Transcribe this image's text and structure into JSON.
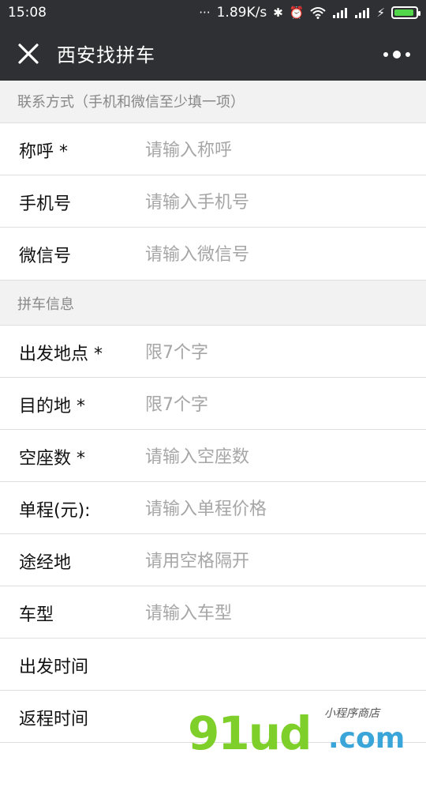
{
  "status_bar": {
    "time": "15:08",
    "indicators": "···",
    "speed": "1.89K/s"
  },
  "titlebar": {
    "title": "西安找拼车"
  },
  "section_contact": {
    "header": "联系方式（手机和微信至少填一项）",
    "rows": [
      {
        "label": "称呼 *",
        "placeholder": "请输入称呼"
      },
      {
        "label": "手机号",
        "placeholder": "请输入手机号"
      },
      {
        "label": "微信号",
        "placeholder": "请输入微信号"
      }
    ]
  },
  "section_trip": {
    "header": "拼车信息",
    "rows": [
      {
        "label": "出发地点 *",
        "placeholder": "限7个字"
      },
      {
        "label": "目的地 *",
        "placeholder": "限7个字"
      },
      {
        "label": "空座数 *",
        "placeholder": "请输入空座数"
      },
      {
        "label": "单程(元):",
        "placeholder": "请输入单程价格"
      },
      {
        "label": "途经地",
        "placeholder": "请用空格隔开"
      },
      {
        "label": "车型",
        "placeholder": "请输入车型"
      },
      {
        "label": "出发时间",
        "placeholder": ""
      },
      {
        "label": "返程时间",
        "placeholder": ""
      }
    ]
  },
  "watermark": {
    "main": "91ud",
    "com": ".com",
    "small": "小程序商店"
  },
  "colors": {
    "bar": "#2f3033",
    "section_bg": "#f2f2f2",
    "placeholder": "#a6a6a6",
    "battery": "#51d64a"
  }
}
